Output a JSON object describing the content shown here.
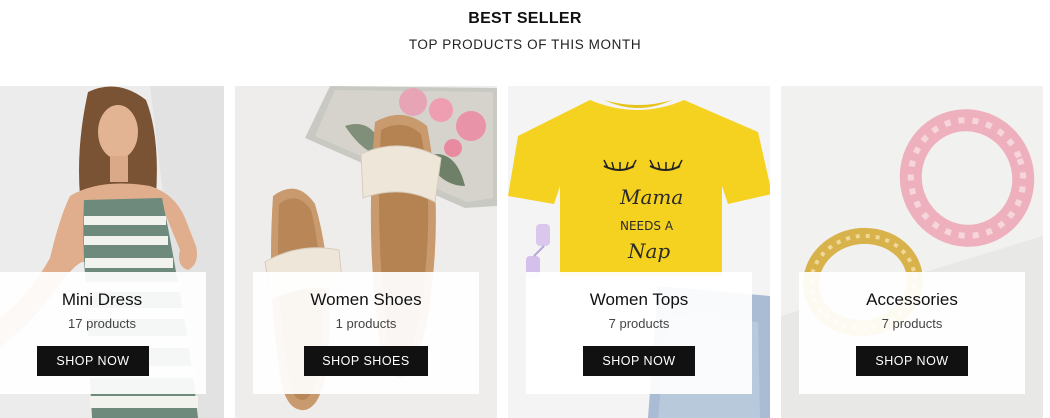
{
  "section": {
    "title": "BEST SELLER",
    "subtitle": "TOP PRODUCTS OF THIS MONTH"
  },
  "categories": [
    {
      "name": "Mini Dress",
      "count": "17 products",
      "button": "SHOP NOW",
      "image": "woman-in-striped-dress-photo"
    },
    {
      "name": "Women Shoes",
      "count": "1 products",
      "button": "SHOP SHOES",
      "image": "beige-flat-sandals-photo"
    },
    {
      "name": "Women Tops",
      "count": "7 products",
      "button": "SHOP NOW",
      "image": "yellow-tshirt-photo"
    },
    {
      "name": "Accessories",
      "count": "7 products",
      "button": "SHOP NOW",
      "image": "headbands-photo"
    }
  ],
  "product_print": "Mama NEEDS A Nap",
  "colors": {
    "button_bg": "#111111",
    "button_text": "#ffffff",
    "overlay_bg": "#ffffff",
    "tshirt_yellow": "#f4d21f"
  }
}
